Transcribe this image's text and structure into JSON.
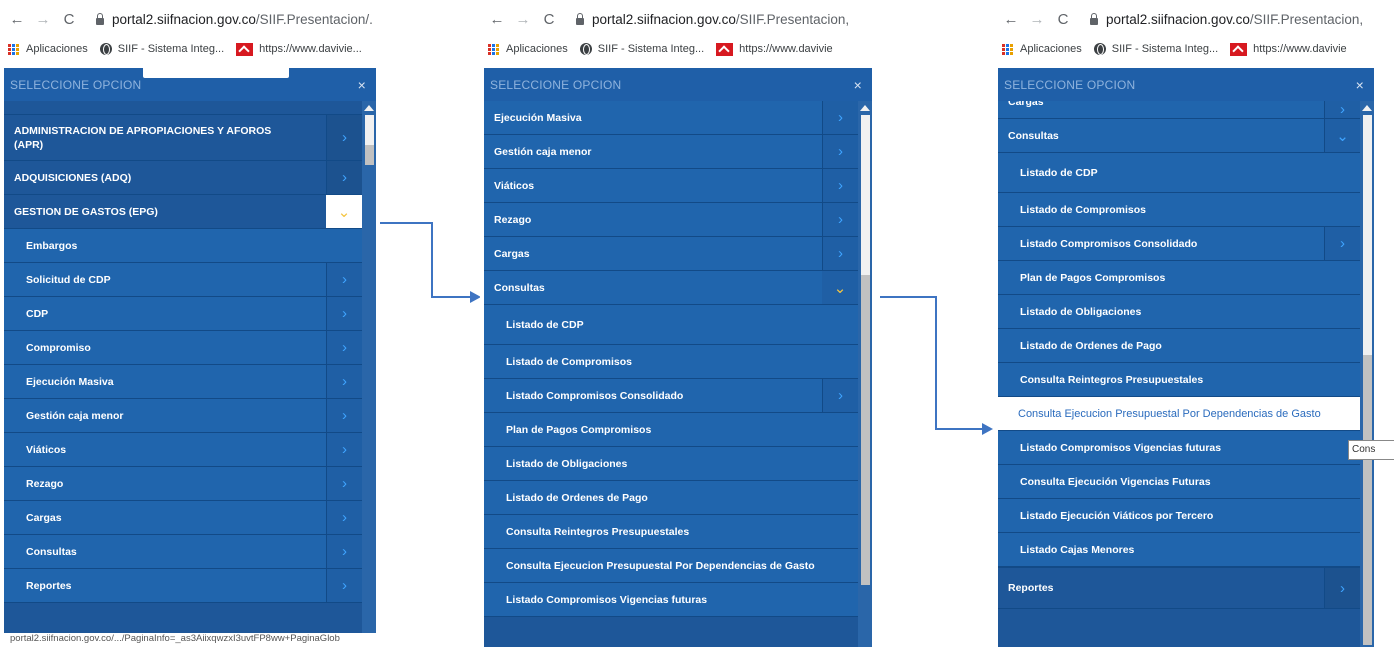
{
  "browser": {
    "url_host": "portal2.siifnacion.gov.co",
    "url_path_1": "/SIIF.Presentacion/.",
    "url_path_2": "/SIIF.Presentacion,",
    "url_path_3": "/SIIF.Presentacion,",
    "bookmarks": {
      "apps": "Aplicaciones",
      "siif": "SIIF - Sistema Integ...",
      "davivienda_1": "https://www.davivie...",
      "davivienda_2": "https://www.davivie",
      "davivienda_3": "https://www.davivie"
    },
    "status_url": "portal2.siifnacion.gov.co/.../PaginaInfo=_as3AiixqwzxI3uvtFP8ww+PaginaGlob"
  },
  "panel_title": "SELECCIONE OPCION",
  "close_glyph": "×",
  "panel1": {
    "items": [
      {
        "label": "ADMINISTRACION DE APROPIACIONES Y AFOROS (APR)"
      },
      {
        "label": "ADQUISICIONES (ADQ)"
      },
      {
        "label": "GESTION DE GASTOS (EPG)"
      },
      {
        "label": "Embargos"
      },
      {
        "label": "Solicitud de CDP"
      },
      {
        "label": "CDP"
      },
      {
        "label": "Compromiso"
      },
      {
        "label": "Ejecución Masiva"
      },
      {
        "label": "Gestión caja menor"
      },
      {
        "label": "Viáticos"
      },
      {
        "label": "Rezago"
      },
      {
        "label": "Cargas"
      },
      {
        "label": "Consultas"
      },
      {
        "label": "Reportes"
      }
    ]
  },
  "panel2": {
    "items": [
      {
        "label": "Ejecución Masiva"
      },
      {
        "label": "Gestión caja menor"
      },
      {
        "label": "Viáticos"
      },
      {
        "label": "Rezago"
      },
      {
        "label": "Cargas"
      },
      {
        "label": "Consultas"
      },
      {
        "label": "Listado de CDP"
      },
      {
        "label": "Listado de Compromisos"
      },
      {
        "label": "Listado Compromisos Consolidado"
      },
      {
        "label": "Plan de Pagos Compromisos"
      },
      {
        "label": "Listado de Obligaciones"
      },
      {
        "label": "Listado de Ordenes de Pago"
      },
      {
        "label": "Consulta Reintegros Presupuestales"
      },
      {
        "label": "Consulta Ejecucion Presupuestal Por Dependencias de Gasto"
      },
      {
        "label": "Listado Compromisos Vigencias futuras"
      }
    ]
  },
  "panel3": {
    "items": [
      {
        "label": "Cargas"
      },
      {
        "label": "Consultas"
      },
      {
        "label": "Listado de CDP"
      },
      {
        "label": "Listado de Compromisos"
      },
      {
        "label": "Listado Compromisos Consolidado"
      },
      {
        "label": "Plan de Pagos Compromisos"
      },
      {
        "label": "Listado de Obligaciones"
      },
      {
        "label": "Listado de Ordenes de Pago"
      },
      {
        "label": "Consulta Reintegros Presupuestales"
      },
      {
        "label": "Consulta Ejecucion Presupuestal Por Dependencias de Gasto"
      },
      {
        "label": "Listado Compromisos Vigencias futuras"
      },
      {
        "label": "Consulta Ejecución Vigencias Futuras"
      },
      {
        "label": "Listado Ejecución Viáticos por Tercero"
      },
      {
        "label": "Listado Cajas Menores"
      },
      {
        "label": "Reportes"
      }
    ],
    "tooltip": "Cons"
  },
  "glyphs": {
    "chevron_right": "›",
    "chevron_down": "⌄"
  }
}
